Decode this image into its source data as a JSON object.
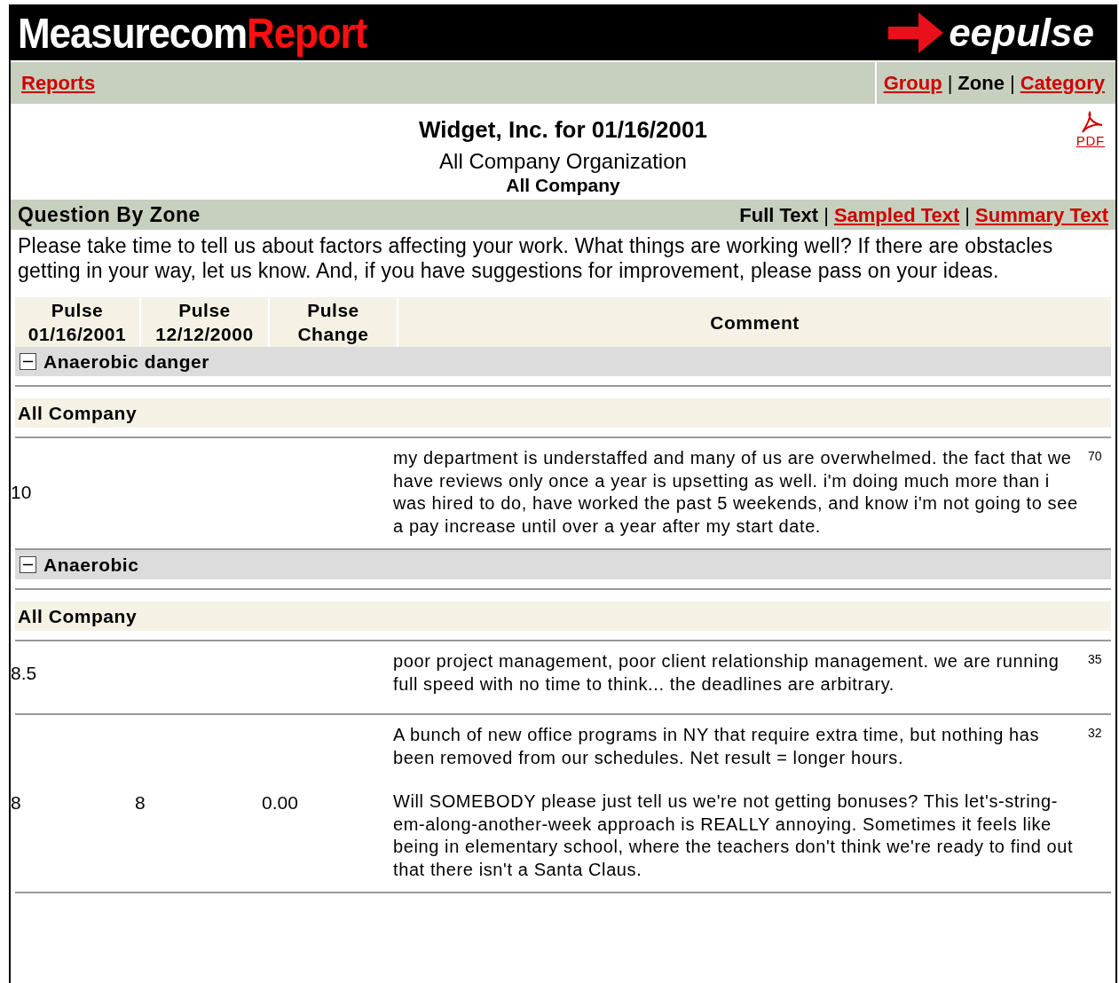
{
  "header": {
    "logo_main": "Measurecom",
    "logo_accent": "Report",
    "brand": "eepulse"
  },
  "nav": {
    "left": [
      {
        "kind": "link",
        "label": "Reports"
      }
    ],
    "right": [
      {
        "kind": "link",
        "label": "Group"
      },
      {
        "kind": "separator",
        "label": "|"
      },
      {
        "kind": "text",
        "label": "Zone"
      },
      {
        "kind": "separator",
        "label": "|"
      },
      {
        "kind": "link",
        "label": "Category"
      }
    ]
  },
  "report": {
    "title": "Widget, Inc. for 01/16/2001",
    "subtitle": "All Company Organization",
    "scope": "All Company",
    "pdf_label": "PDF"
  },
  "question_bar": {
    "title": "Question By Zone",
    "views": [
      {
        "kind": "text",
        "label": "Full Text"
      },
      {
        "kind": "separator",
        "label": "|"
      },
      {
        "kind": "link",
        "label": "Sampled Text"
      },
      {
        "kind": "separator",
        "label": "|"
      },
      {
        "kind": "link",
        "label": "Summary Text"
      }
    ]
  },
  "prompt": "Please take time to tell us about factors affecting your work. What things are working well? If there are obstacles getting in your way, let us know. And, if you have suggestions for improvement, please pass on your ideas.",
  "columns": [
    {
      "line1": "Pulse",
      "line2": "01/16/2001"
    },
    {
      "line1": "Pulse",
      "line2": "12/12/2000"
    },
    {
      "line1": "Pulse",
      "line2": "Change"
    },
    {
      "line1": "Comment"
    }
  ],
  "groups": [
    {
      "label": "Anaerobic danger",
      "expanded": true,
      "subgroups": [
        {
          "label": "All Company",
          "rows": [
            {
              "pulse_current": "10",
              "comments": [
                "my department is understaffed and many of us are overwhelmed. the fact that we have reviews only once a year is upsetting as well. i'm doing much more than i was hired to do, have worked the past 5 weekends, and know i'm not going to see a pay increase until over a year after my start date."
              ],
              "count": "70"
            }
          ]
        }
      ]
    },
    {
      "label": "Anaerobic",
      "expanded": true,
      "subgroups": [
        {
          "label": "All Company",
          "rows": [
            {
              "pulse_current": "8.5",
              "comments": [
                "poor project management, poor client relationship management. we are running full speed with no time to think... the deadlines are arbitrary."
              ],
              "count": "35"
            },
            {
              "pulse_current": "8",
              "pulse_previous": "8",
              "pulse_change": "0.00",
              "comments": [
                "A bunch of new office programs in NY that require extra time, but nothing has been removed from our schedules. Net result = longer hours.",
                "Will SOMEBODY please just tell us we're not getting bonuses? This let's-string-em-along-another-week approach is REALLY annoying. Sometimes it feels like being in elementary school, where the teachers don't think we're ready to find out that there isn't a Santa Claus."
              ],
              "count": "32"
            }
          ]
        }
      ]
    }
  ]
}
